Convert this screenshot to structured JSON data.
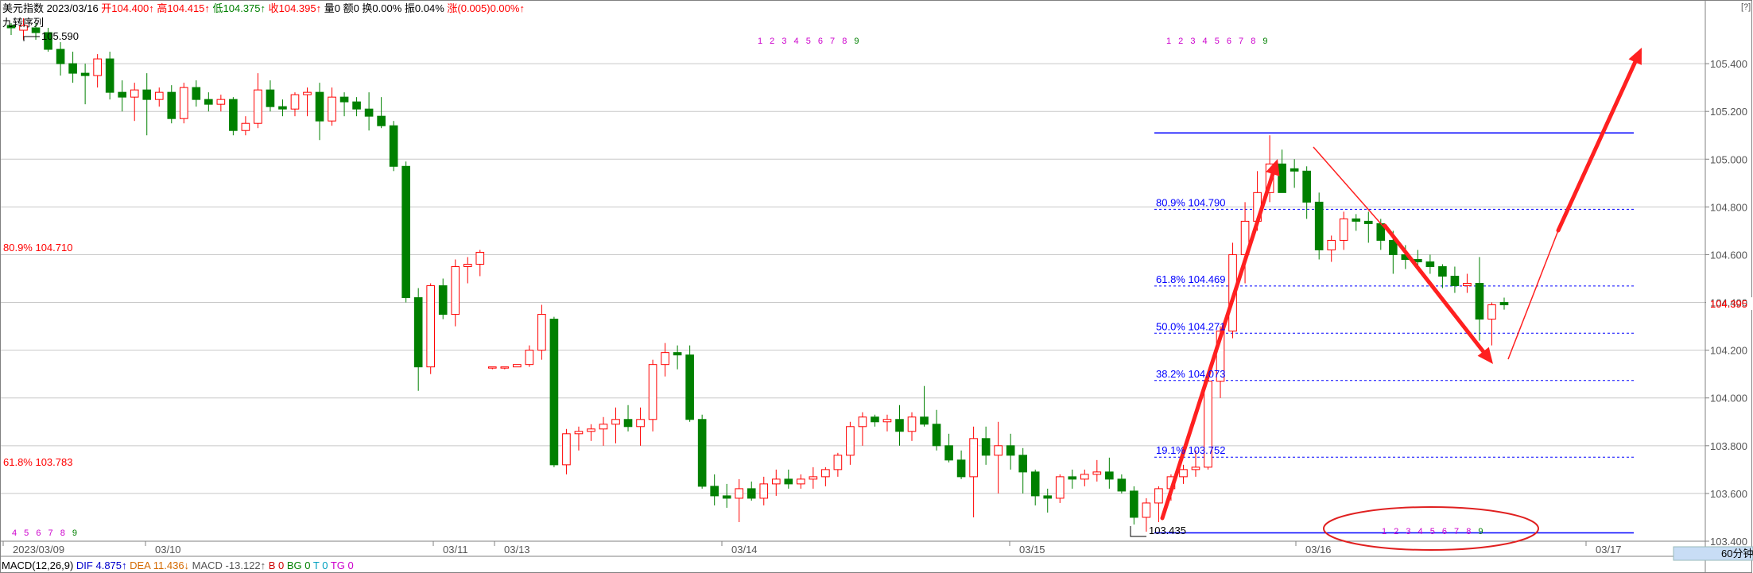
{
  "header": {
    "symbol": "美元指数",
    "date": "2023/03/16",
    "open": "开104.400↑",
    "high": "高104.415↑",
    "low": "低104.375↑",
    "close": "收104.395↑",
    "volume": "量0",
    "amount": "额0",
    "turnover": "换0.00%",
    "amplitude": "振0.04%",
    "change": "涨(0.005)0.00%↑",
    "indicator_name": "九转序列"
  },
  "colors": {
    "up": "#ff0000",
    "down": "#008000",
    "fib": "#0000ff",
    "arrow": "#ff2020",
    "nine": "#cc00cc",
    "grid": "#c8c8c8"
  },
  "labels": {
    "max_label": "105.590",
    "min_label": "103.435",
    "left_fib_1": "80.9% 104.710",
    "left_fib_2": "61.8% 103.783",
    "current_price": "104.395",
    "period": "60分钟",
    "corner_badge": "[?]"
  },
  "nine_sequences": [
    {
      "text": "1 2 3 4 5 6 7 8",
      "end": "9"
    },
    {
      "text": "1 2 3 4 5 6 7 8",
      "end": "9"
    },
    {
      "text": "1 2 3 4 5 6 7 8",
      "end": "9"
    },
    {
      "text": "4 5 6 7 8",
      "end": "9"
    }
  ],
  "fib_levels": [
    {
      "label": "80.9% 104.790",
      "price": 104.79
    },
    {
      "label": "61.8% 104.469",
      "price": 104.469
    },
    {
      "label": "50.0% 104.271",
      "price": 104.271
    },
    {
      "label": "38.2% 104.073",
      "price": 104.073
    },
    {
      "label": "19.1% 103.752",
      "price": 103.752
    }
  ],
  "fib_high": 105.11,
  "fib_low": 103.435,
  "macd": {
    "name": "MACD(12,26,9)",
    "dif": "DIF 4.875↑",
    "dea": "DEA 11.436↓",
    "macd": "MACD -13.122↑",
    "b": "B 0",
    "bg": "BG 0",
    "t": "T 0",
    "tg": "TG 0"
  },
  "chart_data": {
    "type": "candlestick",
    "ylim": [
      103.4,
      105.62
    ],
    "y_ticks": [
      "105.400",
      "105.200",
      "105.000",
      "104.800",
      "104.600",
      "104.400",
      "104.200",
      "104.000",
      "103.800",
      "103.600",
      "103.400"
    ],
    "x_ticks": [
      "2023/03/09",
      "03/10",
      "03/11",
      "03/13",
      "03/14",
      "03/15",
      "03/16",
      "03/17"
    ],
    "candles": [
      [
        105.56,
        105.57,
        105.52,
        105.55
      ],
      [
        105.54,
        105.59,
        105.5,
        105.56
      ],
      [
        105.55,
        105.57,
        105.5,
        105.53
      ],
      [
        105.53,
        105.55,
        105.45,
        105.46
      ],
      [
        105.46,
        105.49,
        105.35,
        105.4
      ],
      [
        105.4,
        105.45,
        105.32,
        105.36
      ],
      [
        105.36,
        105.4,
        105.23,
        105.35
      ],
      [
        105.35,
        105.44,
        105.3,
        105.42
      ],
      [
        105.42,
        105.45,
        105.25,
        105.28
      ],
      [
        105.28,
        105.33,
        105.2,
        105.26
      ],
      [
        105.26,
        105.32,
        105.16,
        105.29
      ],
      [
        105.29,
        105.36,
        105.1,
        105.25
      ],
      [
        105.25,
        105.3,
        105.22,
        105.28
      ],
      [
        105.28,
        105.31,
        105.15,
        105.17
      ],
      [
        105.17,
        105.32,
        105.15,
        105.3
      ],
      [
        105.3,
        105.33,
        105.22,
        105.25
      ],
      [
        105.25,
        105.28,
        105.2,
        105.23
      ],
      [
        105.23,
        105.27,
        105.2,
        105.25
      ],
      [
        105.25,
        105.26,
        105.1,
        105.12
      ],
      [
        105.12,
        105.18,
        105.1,
        105.15
      ],
      [
        105.15,
        105.36,
        105.13,
        105.29
      ],
      [
        105.29,
        105.33,
        105.2,
        105.22
      ],
      [
        105.22,
        105.25,
        105.18,
        105.21
      ],
      [
        105.21,
        105.28,
        105.18,
        105.27
      ],
      [
        105.27,
        105.3,
        105.18,
        105.28
      ],
      [
        105.28,
        105.32,
        105.08,
        105.16
      ],
      [
        105.16,
        105.3,
        105.14,
        105.26
      ],
      [
        105.26,
        105.28,
        105.18,
        105.24
      ],
      [
        105.24,
        105.26,
        105.18,
        105.21
      ],
      [
        105.21,
        105.28,
        105.12,
        105.18
      ],
      [
        105.18,
        105.26,
        105.13,
        105.14
      ],
      [
        105.14,
        105.16,
        104.95,
        104.97
      ],
      [
        104.97,
        104.99,
        104.4,
        104.42
      ],
      [
        104.42,
        104.46,
        104.03,
        104.13
      ],
      [
        104.13,
        104.48,
        104.1,
        104.47
      ],
      [
        104.47,
        104.5,
        104.33,
        104.35
      ],
      [
        104.35,
        104.58,
        104.3,
        104.55
      ],
      [
        104.55,
        104.59,
        104.48,
        104.56
      ],
      [
        104.56,
        104.62,
        104.51,
        104.61
      ],
      [
        104.13,
        104.13,
        104.12,
        104.13
      ],
      [
        104.13,
        104.13,
        104.12,
        104.13
      ],
      [
        104.13,
        104.14,
        104.13,
        104.14
      ],
      [
        104.14,
        104.22,
        104.13,
        104.2
      ],
      [
        104.2,
        104.39,
        104.16,
        104.35
      ],
      [
        104.33,
        104.34,
        103.71,
        103.72
      ],
      [
        103.72,
        103.87,
        103.68,
        103.85
      ],
      [
        103.85,
        103.88,
        103.78,
        103.86
      ],
      [
        103.86,
        103.89,
        103.82,
        103.87
      ],
      [
        103.87,
        103.92,
        103.8,
        103.89
      ],
      [
        103.89,
        103.96,
        103.81,
        103.91
      ],
      [
        103.91,
        103.97,
        103.86,
        103.88
      ],
      [
        103.88,
        103.96,
        103.8,
        103.91
      ],
      [
        103.91,
        104.16,
        103.86,
        104.14
      ],
      [
        104.14,
        104.23,
        104.09,
        104.19
      ],
      [
        104.19,
        104.22,
        104.12,
        104.18
      ],
      [
        104.18,
        104.22,
        103.9,
        103.91
      ],
      [
        103.91,
        103.93,
        103.62,
        103.63
      ],
      [
        103.63,
        103.68,
        103.55,
        103.59
      ],
      [
        103.59,
        103.64,
        103.54,
        103.58
      ],
      [
        103.58,
        103.66,
        103.48,
        103.62
      ],
      [
        103.62,
        103.65,
        103.57,
        103.58
      ],
      [
        103.58,
        103.67,
        103.55,
        103.64
      ],
      [
        103.64,
        103.7,
        103.59,
        103.66
      ],
      [
        103.66,
        103.7,
        103.62,
        103.64
      ],
      [
        103.64,
        103.68,
        103.62,
        103.66
      ],
      [
        103.66,
        103.71,
        103.62,
        103.67
      ],
      [
        103.67,
        103.71,
        103.63,
        103.7
      ],
      [
        103.7,
        103.77,
        103.67,
        103.76
      ],
      [
        103.76,
        103.9,
        103.72,
        103.88
      ],
      [
        103.88,
        103.94,
        103.8,
        103.92
      ],
      [
        103.92,
        103.93,
        103.88,
        103.9
      ],
      [
        103.9,
        103.93,
        103.86,
        103.91
      ],
      [
        103.91,
        103.97,
        103.8,
        103.86
      ],
      [
        103.86,
        103.94,
        103.82,
        103.92
      ],
      [
        103.92,
        104.05,
        103.88,
        103.89
      ],
      [
        103.89,
        103.95,
        103.78,
        103.8
      ],
      [
        103.8,
        103.85,
        103.73,
        103.74
      ],
      [
        103.74,
        103.78,
        103.66,
        103.67
      ],
      [
        103.67,
        103.88,
        103.5,
        103.83
      ],
      [
        103.83,
        103.88,
        103.72,
        103.76
      ],
      [
        103.76,
        103.9,
        103.6,
        103.8
      ],
      [
        103.8,
        103.85,
        103.7,
        103.76
      ],
      [
        103.76,
        103.79,
        103.6,
        103.69
      ],
      [
        103.69,
        103.7,
        103.55,
        103.59
      ],
      [
        103.59,
        103.62,
        103.52,
        103.58
      ],
      [
        103.58,
        103.68,
        103.56,
        103.67
      ],
      [
        103.67,
        103.7,
        103.62,
        103.66
      ],
      [
        103.66,
        103.7,
        103.63,
        103.68
      ],
      [
        103.68,
        103.74,
        103.65,
        103.69
      ],
      [
        103.69,
        103.75,
        103.62,
        103.66
      ],
      [
        103.66,
        103.68,
        103.6,
        103.61
      ],
      [
        103.61,
        103.63,
        103.47,
        103.5
      ],
      [
        103.5,
        103.58,
        103.44,
        103.56
      ],
      [
        103.56,
        103.63,
        103.48,
        103.62
      ],
      [
        103.62,
        103.68,
        103.57,
        103.67
      ],
      [
        103.67,
        103.72,
        103.64,
        103.7
      ],
      [
        103.7,
        103.78,
        103.67,
        103.71
      ],
      [
        103.71,
        104.1,
        103.7,
        104.07
      ],
      [
        104.07,
        104.3,
        104.0,
        104.28
      ],
      [
        104.28,
        104.65,
        104.25,
        104.6
      ],
      [
        104.6,
        104.82,
        104.48,
        104.74
      ],
      [
        104.74,
        104.95,
        104.7,
        104.86
      ],
      [
        104.86,
        105.1,
        104.82,
        104.98
      ],
      [
        104.98,
        105.04,
        104.86,
        104.86
      ],
      [
        104.96,
        105.0,
        104.88,
        104.95
      ],
      [
        104.95,
        104.97,
        104.75,
        104.82
      ],
      [
        104.82,
        104.86,
        104.58,
        104.62
      ],
      [
        104.62,
        104.68,
        104.57,
        104.66
      ],
      [
        104.66,
        104.78,
        104.62,
        104.75
      ],
      [
        104.75,
        104.77,
        104.7,
        104.74
      ],
      [
        104.74,
        104.78,
        104.65,
        104.73
      ],
      [
        104.73,
        104.75,
        104.62,
        104.66
      ],
      [
        104.66,
        104.7,
        104.52,
        104.6
      ],
      [
        104.6,
        104.64,
        104.54,
        104.58
      ],
      [
        104.58,
        104.62,
        104.55,
        104.57
      ],
      [
        104.57,
        104.6,
        104.52,
        104.55
      ],
      [
        104.55,
        104.56,
        104.46,
        104.51
      ],
      [
        104.51,
        104.55,
        104.44,
        104.47
      ],
      [
        104.47,
        104.52,
        104.44,
        104.48
      ],
      [
        104.48,
        104.59,
        104.24,
        104.33
      ],
      [
        104.33,
        104.4,
        104.22,
        104.39
      ],
      [
        104.4,
        104.42,
        104.37,
        104.39
      ]
    ]
  }
}
